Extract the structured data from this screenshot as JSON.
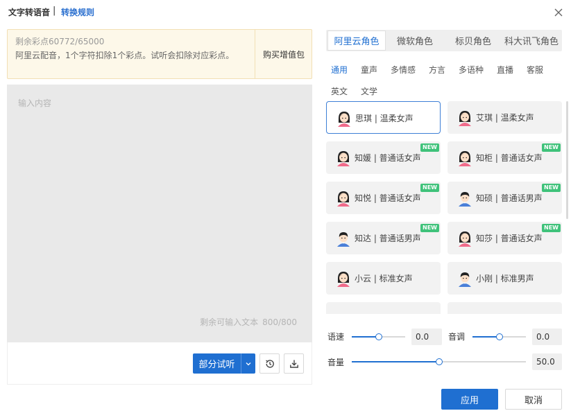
{
  "header": {
    "title": "文字转语音",
    "separator": "|",
    "rules_link": "转换规则",
    "close_icon": "close-icon"
  },
  "notice": {
    "balance": "剩余彩点60772/65000",
    "description": "阿里云配音，1个字符扣除1个彩点。试听会扣除对应彩点。",
    "buy_label": "购买增值包"
  },
  "editor": {
    "placeholder": "输入内容",
    "remaining_label": "剩余可输入文本",
    "remaining_count": "800/800"
  },
  "actions": {
    "preview_label": "部分试听",
    "history_icon": "history-icon",
    "download_icon": "download-icon"
  },
  "vendor_tabs": [
    "阿里云角色",
    "微软角色",
    "标贝角色",
    "科大讯飞角色"
  ],
  "categories": [
    "通用",
    "童声",
    "多情感",
    "方言",
    "多语种",
    "直播",
    "客服",
    "英文",
    "文学"
  ],
  "voices": [
    {
      "name": "思琪 | 温柔女声",
      "gender": "female",
      "is_new": false,
      "selected": true
    },
    {
      "name": "艾琪 | 温柔女声",
      "gender": "female",
      "is_new": false,
      "selected": false
    },
    {
      "name": "知媛 | 普通话女声",
      "gender": "female",
      "is_new": true,
      "selected": false
    },
    {
      "name": "知柜 | 普通话女声",
      "gender": "female",
      "is_new": true,
      "selected": false
    },
    {
      "name": "知悦 | 普通话女声",
      "gender": "female",
      "is_new": true,
      "selected": false
    },
    {
      "name": "知硕 | 普通话男声",
      "gender": "male",
      "is_new": true,
      "selected": false
    },
    {
      "name": "知达 | 普通话男声",
      "gender": "male",
      "is_new": true,
      "selected": false
    },
    {
      "name": "知莎 | 普通话女声",
      "gender": "female",
      "is_new": true,
      "selected": false
    },
    {
      "name": "小云 | 标准女声",
      "gender": "female",
      "is_new": false,
      "selected": false
    },
    {
      "name": "小刚 | 标准男声",
      "gender": "male",
      "is_new": false,
      "selected": false
    }
  ],
  "badge_new": "NEW",
  "controls": {
    "speed": {
      "label": "语速",
      "value": "0.0",
      "fraction": 0.5
    },
    "pitch": {
      "label": "音调",
      "value": "0.0",
      "fraction": 0.5
    },
    "volume": {
      "label": "音量",
      "value": "50.0",
      "fraction": 0.5
    }
  },
  "footer": {
    "apply_label": "应用",
    "cancel_label": "取消"
  },
  "colors": {
    "accent": "#1f6fd1",
    "new_badge": "#3fc27a",
    "notice_bg": "#fdf8e9"
  }
}
